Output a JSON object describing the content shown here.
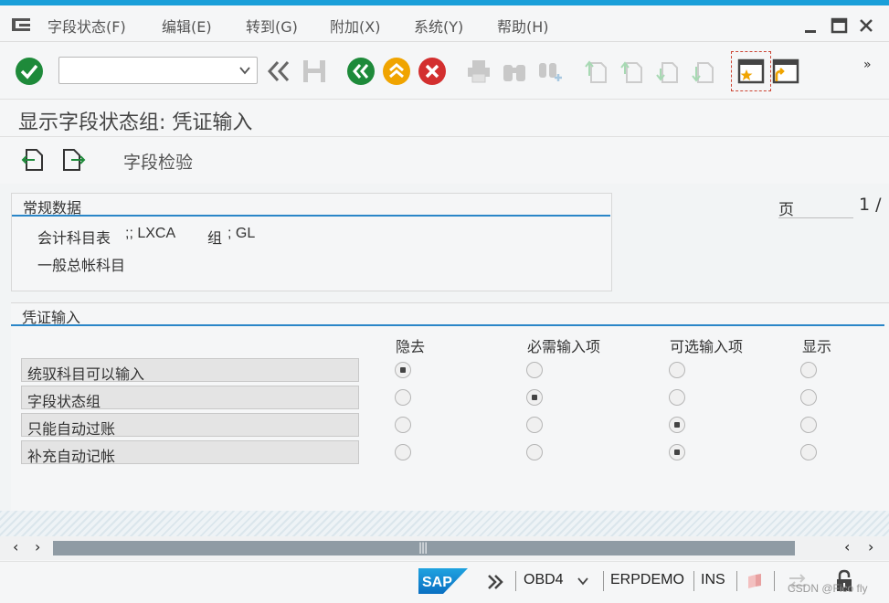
{
  "menu": {
    "items": [
      "字段状态(F)",
      "编辑(E)",
      "转到(G)",
      "附加(X)",
      "系统(Y)",
      "帮助(H)"
    ]
  },
  "toolbar": {
    "command_value": "",
    "more": "»"
  },
  "title": "显示字段状态组: 凭证输入",
  "app_toolbar": {
    "field_check": "字段检验"
  },
  "general": {
    "title": "常规数据",
    "line1_label": "会计科目表",
    "line1_value": ";; LXCA",
    "line1_group_label": "组",
    "line1_group_value": "; GL",
    "line2": "一般总帐科目",
    "page_label": "页",
    "page_number": "1 /"
  },
  "voucher": {
    "title": "凭证输入",
    "columns": [
      "隐去",
      "必需输入项",
      "可选输入项",
      "显示"
    ],
    "rows": [
      {
        "label": "统驭科目可以输入",
        "selected": 0
      },
      {
        "label": "字段状态组",
        "selected": 1
      },
      {
        "label": "只能自动过账",
        "selected": 2
      },
      {
        "label": "补充自动记帐",
        "selected": 2
      }
    ]
  },
  "status": {
    "system": "OBD4",
    "client": "ERPDEMO",
    "mode": "INS",
    "watermark": "CSDN @Fico fly"
  },
  "colors": {
    "accent": "#1a9fd9",
    "green": "#1e8a3a",
    "orange": "#f0a400",
    "red": "#d32f2f"
  }
}
